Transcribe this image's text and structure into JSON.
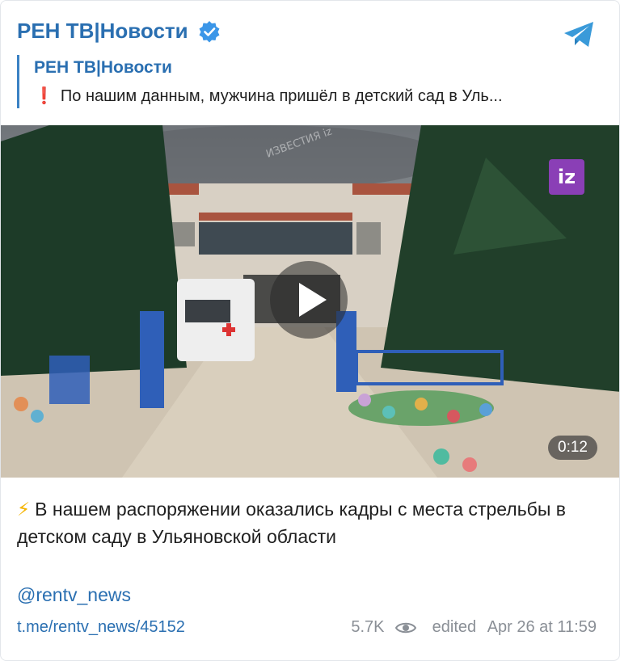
{
  "header": {
    "channel_name": "РЕН ТВ|Новости",
    "verified_icon": "verified-badge-icon",
    "app_icon": "telegram-icon"
  },
  "reply": {
    "title": "РЕН ТВ|Новости",
    "mark": "❗",
    "text": "По нашим данным, мужчина пришёл в детский сад в Уль..."
  },
  "media": {
    "watermark": "ИЗВЕСТИЯ iz",
    "badge": "iz",
    "duration": "0:12",
    "play_icon": "play-icon"
  },
  "post": {
    "bolt": "⚡",
    "text": "В нашем распоряжении оказались кадры с места стрельбы в детском саду в Ульяновской области",
    "handle": "@rentv_news"
  },
  "footer": {
    "link": "t.me/rentv_news/45152",
    "views": "5.7K",
    "edited": "edited",
    "datetime": "Apr 26 at 11:59"
  },
  "colors": {
    "accent": "#2a6fb1",
    "meta": "#8a8f96",
    "badge": "#8a3fb6"
  }
}
